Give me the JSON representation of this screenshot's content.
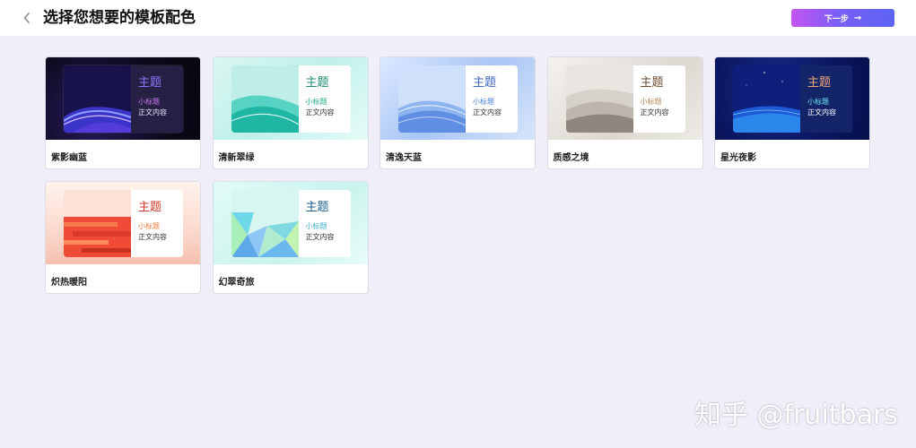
{
  "header": {
    "back_icon": "chevron-left-icon",
    "title": "选择您想要的模板配色",
    "next_label": "下一步",
    "next_arrow": "→",
    "next_colors": [
      "#c454f0",
      "#5a63f2"
    ]
  },
  "templates": [
    {
      "name": "紫影幽蓝",
      "slide_title": "主题",
      "slide_subtitle": "小标题",
      "slide_body": "正文内容",
      "accent": "#7d6cf5",
      "subtitle_color": "#c979f0"
    },
    {
      "name": "清新翠绿",
      "slide_title": "主题",
      "slide_subtitle": "小标题",
      "slide_body": "正文内容",
      "accent": "#1e8a73",
      "subtitle_color": "#21a886"
    },
    {
      "name": "清逸天蓝",
      "slide_title": "主题",
      "slide_subtitle": "小标题",
      "slide_body": "正文内容",
      "accent": "#3f64c5",
      "subtitle_color": "#4a7de0"
    },
    {
      "name": "质感之境",
      "slide_title": "主题",
      "slide_subtitle": "小标题",
      "slide_body": "正文内容",
      "accent": "#6b4a2e",
      "subtitle_color": "#b8865a"
    },
    {
      "name": "星光夜影",
      "slide_title": "主题",
      "slide_subtitle": "小标题",
      "slide_body": "正文内容",
      "accent": "#f0a77a",
      "subtitle_color": "#6ee3f0"
    },
    {
      "name": "炽热暖阳",
      "slide_title": "主题",
      "slide_subtitle": "小标题",
      "slide_body": "正文内容",
      "accent": "#d43a2c",
      "subtitle_color": "#f07a3a"
    },
    {
      "name": "幻翠奇旅",
      "slide_title": "主题",
      "slide_subtitle": "小标题",
      "slide_body": "正文内容",
      "accent": "#1f5f8f",
      "subtitle_color": "#3bb0c8"
    }
  ],
  "watermark": "知乎 @fruitbars"
}
